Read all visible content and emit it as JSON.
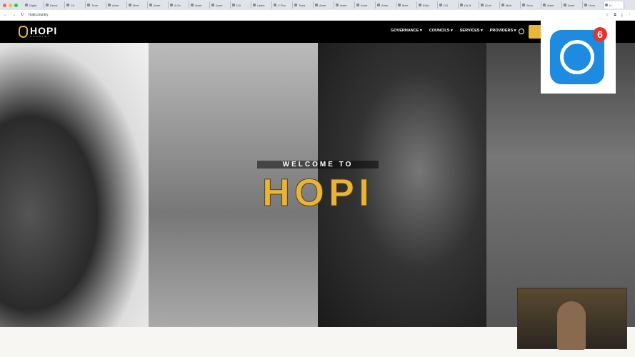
{
  "browser": {
    "tabs": [
      "Digita",
      "Decor",
      "Ch",
      "Trum",
      "Amer",
      "Mexi",
      "Amer",
      "A Go",
      "Amer",
      "Amer",
      "DJI",
      "Uptim",
      "X Pho",
      "Tesla",
      "Amer",
      "Amer",
      "Amer",
      "Amer",
      "Mexi",
      "Ethic",
      "DJI",
      "(3) M",
      "(3) el",
      "Mich",
      "Seco",
      "Amer",
      "Amer",
      "Venu",
      "H"
    ],
    "url": "hopi.country"
  },
  "site": {
    "logo": "HOPI",
    "logo_sub": "COUNTRY",
    "menu": [
      "GOVERNANCE ▾",
      "COUNCILS ▾",
      "SERVICES ▾",
      "PROVIDERS ▾"
    ],
    "hero_welcome": "WELCOME TO",
    "hero_title": "HOPI"
  },
  "overlay": {
    "badge": "6"
  },
  "colors": {
    "accent": "#e8b43a",
    "app_icon": "#1f8be0",
    "badge": "#e2362a"
  }
}
